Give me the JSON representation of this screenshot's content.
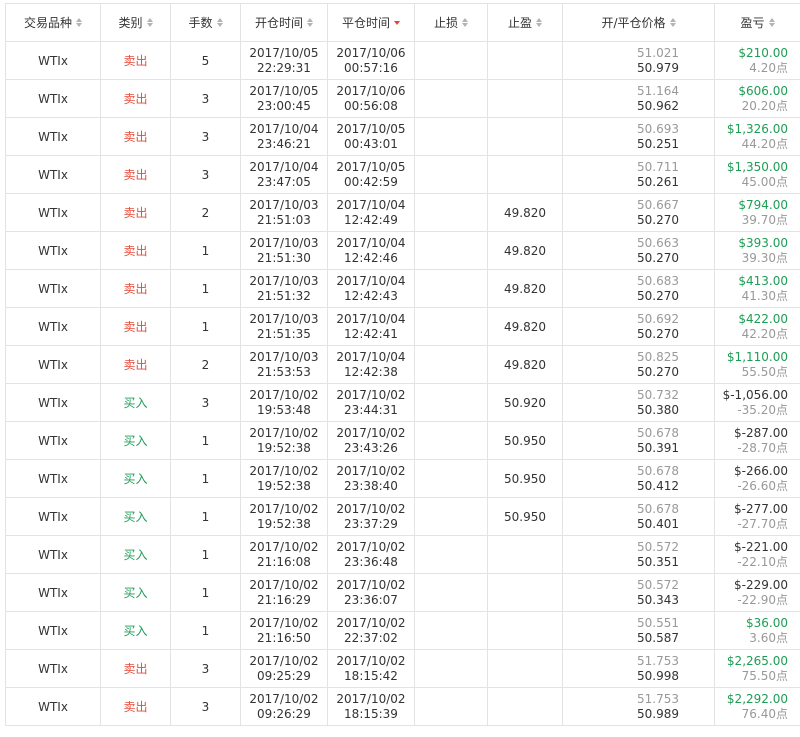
{
  "headers": {
    "symbol": "交易品种",
    "side": "类别",
    "lots": "手数",
    "open_time": "开仓时间",
    "close_time": "平仓时间",
    "stop_loss": "止损",
    "take_profit": "止盈",
    "price": "开/平仓价格",
    "profit": "盈亏"
  },
  "colors": {
    "sell": "#e74c3c",
    "buy": "#1f9d55",
    "sort_active": "#e8423a"
  },
  "rows": [
    {
      "symbol": "WTIx",
      "side": "卖出",
      "side_type": "sell",
      "lots": "5",
      "open_date": "2017/10/05",
      "open_clock": "22:29:31",
      "close_date": "2017/10/06",
      "close_clock": "00:57:16",
      "sl": "",
      "tp": "",
      "open_price": "51.021",
      "close_price": "50.979",
      "pl": "$210.00",
      "pts": "4.20点",
      "pl_sign": "pos"
    },
    {
      "symbol": "WTIx",
      "side": "卖出",
      "side_type": "sell",
      "lots": "3",
      "open_date": "2017/10/05",
      "open_clock": "23:00:45",
      "close_date": "2017/10/06",
      "close_clock": "00:56:08",
      "sl": "",
      "tp": "",
      "open_price": "51.164",
      "close_price": "50.962",
      "pl": "$606.00",
      "pts": "20.20点",
      "pl_sign": "pos"
    },
    {
      "symbol": "WTIx",
      "side": "卖出",
      "side_type": "sell",
      "lots": "3",
      "open_date": "2017/10/04",
      "open_clock": "23:46:21",
      "close_date": "2017/10/05",
      "close_clock": "00:43:01",
      "sl": "",
      "tp": "",
      "open_price": "50.693",
      "close_price": "50.251",
      "pl": "$1,326.00",
      "pts": "44.20点",
      "pl_sign": "pos"
    },
    {
      "symbol": "WTIx",
      "side": "卖出",
      "side_type": "sell",
      "lots": "3",
      "open_date": "2017/10/04",
      "open_clock": "23:47:05",
      "close_date": "2017/10/05",
      "close_clock": "00:42:59",
      "sl": "",
      "tp": "",
      "open_price": "50.711",
      "close_price": "50.261",
      "pl": "$1,350.00",
      "pts": "45.00点",
      "pl_sign": "pos"
    },
    {
      "symbol": "WTIx",
      "side": "卖出",
      "side_type": "sell",
      "lots": "2",
      "open_date": "2017/10/03",
      "open_clock": "21:51:03",
      "close_date": "2017/10/04",
      "close_clock": "12:42:49",
      "sl": "",
      "tp": "49.820",
      "open_price": "50.667",
      "close_price": "50.270",
      "pl": "$794.00",
      "pts": "39.70点",
      "pl_sign": "pos"
    },
    {
      "symbol": "WTIx",
      "side": "卖出",
      "side_type": "sell",
      "lots": "1",
      "open_date": "2017/10/03",
      "open_clock": "21:51:30",
      "close_date": "2017/10/04",
      "close_clock": "12:42:46",
      "sl": "",
      "tp": "49.820",
      "open_price": "50.663",
      "close_price": "50.270",
      "pl": "$393.00",
      "pts": "39.30点",
      "pl_sign": "pos"
    },
    {
      "symbol": "WTIx",
      "side": "卖出",
      "side_type": "sell",
      "lots": "1",
      "open_date": "2017/10/03",
      "open_clock": "21:51:32",
      "close_date": "2017/10/04",
      "close_clock": "12:42:43",
      "sl": "",
      "tp": "49.820",
      "open_price": "50.683",
      "close_price": "50.270",
      "pl": "$413.00",
      "pts": "41.30点",
      "pl_sign": "pos"
    },
    {
      "symbol": "WTIx",
      "side": "卖出",
      "side_type": "sell",
      "lots": "1",
      "open_date": "2017/10/03",
      "open_clock": "21:51:35",
      "close_date": "2017/10/04",
      "close_clock": "12:42:41",
      "sl": "",
      "tp": "49.820",
      "open_price": "50.692",
      "close_price": "50.270",
      "pl": "$422.00",
      "pts": "42.20点",
      "pl_sign": "pos"
    },
    {
      "symbol": "WTIx",
      "side": "卖出",
      "side_type": "sell",
      "lots": "2",
      "open_date": "2017/10/03",
      "open_clock": "21:53:53",
      "close_date": "2017/10/04",
      "close_clock": "12:42:38",
      "sl": "",
      "tp": "49.820",
      "open_price": "50.825",
      "close_price": "50.270",
      "pl": "$1,110.00",
      "pts": "55.50点",
      "pl_sign": "pos"
    },
    {
      "symbol": "WTIx",
      "side": "买入",
      "side_type": "buy",
      "lots": "3",
      "open_date": "2017/10/02",
      "open_clock": "19:53:48",
      "close_date": "2017/10/02",
      "close_clock": "23:44:31",
      "sl": "",
      "tp": "50.920",
      "open_price": "50.732",
      "close_price": "50.380",
      "pl": "$-1,056.00",
      "pts": "-35.20点",
      "pl_sign": "neg"
    },
    {
      "symbol": "WTIx",
      "side": "买入",
      "side_type": "buy",
      "lots": "1",
      "open_date": "2017/10/02",
      "open_clock": "19:52:38",
      "close_date": "2017/10/02",
      "close_clock": "23:43:26",
      "sl": "",
      "tp": "50.950",
      "open_price": "50.678",
      "close_price": "50.391",
      "pl": "$-287.00",
      "pts": "-28.70点",
      "pl_sign": "neg"
    },
    {
      "symbol": "WTIx",
      "side": "买入",
      "side_type": "buy",
      "lots": "1",
      "open_date": "2017/10/02",
      "open_clock": "19:52:38",
      "close_date": "2017/10/02",
      "close_clock": "23:38:40",
      "sl": "",
      "tp": "50.950",
      "open_price": "50.678",
      "close_price": "50.412",
      "pl": "$-266.00",
      "pts": "-26.60点",
      "pl_sign": "neg"
    },
    {
      "symbol": "WTIx",
      "side": "买入",
      "side_type": "buy",
      "lots": "1",
      "open_date": "2017/10/02",
      "open_clock": "19:52:38",
      "close_date": "2017/10/02",
      "close_clock": "23:37:29",
      "sl": "",
      "tp": "50.950",
      "open_price": "50.678",
      "close_price": "50.401",
      "pl": "$-277.00",
      "pts": "-27.70点",
      "pl_sign": "neg"
    },
    {
      "symbol": "WTIx",
      "side": "买入",
      "side_type": "buy",
      "lots": "1",
      "open_date": "2017/10/02",
      "open_clock": "21:16:08",
      "close_date": "2017/10/02",
      "close_clock": "23:36:48",
      "sl": "",
      "tp": "",
      "open_price": "50.572",
      "close_price": "50.351",
      "pl": "$-221.00",
      "pts": "-22.10点",
      "pl_sign": "neg"
    },
    {
      "symbol": "WTIx",
      "side": "买入",
      "side_type": "buy",
      "lots": "1",
      "open_date": "2017/10/02",
      "open_clock": "21:16:29",
      "close_date": "2017/10/02",
      "close_clock": "23:36:07",
      "sl": "",
      "tp": "",
      "open_price": "50.572",
      "close_price": "50.343",
      "pl": "$-229.00",
      "pts": "-22.90点",
      "pl_sign": "neg"
    },
    {
      "symbol": "WTIx",
      "side": "买入",
      "side_type": "buy",
      "lots": "1",
      "open_date": "2017/10/02",
      "open_clock": "21:16:50",
      "close_date": "2017/10/02",
      "close_clock": "22:37:02",
      "sl": "",
      "tp": "",
      "open_price": "50.551",
      "close_price": "50.587",
      "pl": "$36.00",
      "pts": "3.60点",
      "pl_sign": "pos"
    },
    {
      "symbol": "WTIx",
      "side": "卖出",
      "side_type": "sell",
      "lots": "3",
      "open_date": "2017/10/02",
      "open_clock": "09:25:29",
      "close_date": "2017/10/02",
      "close_clock": "18:15:42",
      "sl": "",
      "tp": "",
      "open_price": "51.753",
      "close_price": "50.998",
      "pl": "$2,265.00",
      "pts": "75.50点",
      "pl_sign": "pos"
    },
    {
      "symbol": "WTIx",
      "side": "卖出",
      "side_type": "sell",
      "lots": "3",
      "open_date": "2017/10/02",
      "open_clock": "09:26:29",
      "close_date": "2017/10/02",
      "close_clock": "18:15:39",
      "sl": "",
      "tp": "",
      "open_price": "51.753",
      "close_price": "50.989",
      "pl": "$2,292.00",
      "pts": "76.40点",
      "pl_sign": "pos"
    }
  ]
}
